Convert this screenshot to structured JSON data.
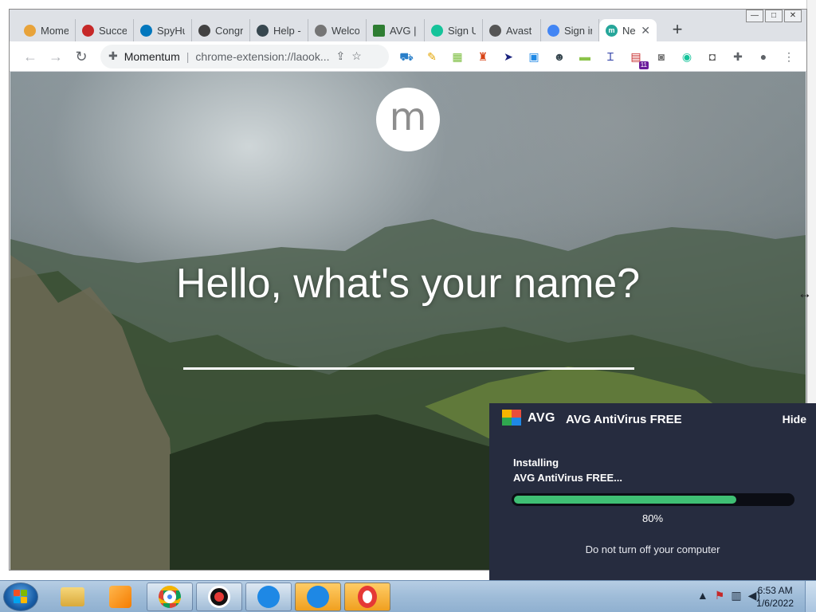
{
  "window": {
    "minimize": "—",
    "maximize": "□",
    "close": "✕"
  },
  "tabs": [
    {
      "label": "Momentum",
      "favicon_color": "#e8a33a"
    },
    {
      "label": "Success",
      "favicon_color": "#c62828"
    },
    {
      "label": "SpyHunter",
      "favicon_color": "#0277bd"
    },
    {
      "label": "Congrats",
      "favicon_color": "#424242"
    },
    {
      "label": "Help",
      "favicon_color": "#37474f"
    },
    {
      "label": "Welcome",
      "favicon_color": "#757575"
    },
    {
      "label": "AVG",
      "favicon_color": "#2e7d32"
    },
    {
      "label": "Sign Up",
      "favicon_color": "#15c39a"
    },
    {
      "label": "Avast",
      "favicon_color": "#555555"
    },
    {
      "label": "Sign in",
      "favicon_color": "#4285f4"
    },
    {
      "label": "New Tab",
      "favicon_color": "#26a69a",
      "active": true
    }
  ],
  "tab_labels_visible": [
    "Mome",
    "Succe",
    "SpyHu",
    "Congr",
    "Help -",
    "Welco",
    "AVG |",
    "Sign U",
    "Avast",
    "Sign in",
    "Ne"
  ],
  "new_tab_symbol": "+",
  "toolbar": {
    "back": "←",
    "forward": "→",
    "reload": "↻",
    "omnibox_site": "Momentum",
    "omnibox_sep": "|",
    "omnibox_url": "chrome-extension://laook...",
    "share": "⇪",
    "bookmark": "☆",
    "extensions_badge": "11",
    "menu": "⋮"
  },
  "page": {
    "logo_letter": "m",
    "greeting": "Hello, what's your name?",
    "name_input_value": ""
  },
  "avg": {
    "logo_text": "AVG",
    "title": "AVG AntiVirus FREE",
    "hide_label": "Hide",
    "status_line1": "Installing",
    "status_line2": "AVG AntiVirus FREE...",
    "progress": 0.8,
    "percent_label": "80%",
    "warning": "Do not turn off your computer",
    "bg_color": "#262c3f",
    "progress_color": "#3fbf74"
  },
  "taskbar": {
    "clock_time": "6:53 AM",
    "clock_date": "1/6/2022",
    "tray_icons": [
      "up-arrow",
      "flag",
      "network",
      "volume"
    ]
  }
}
